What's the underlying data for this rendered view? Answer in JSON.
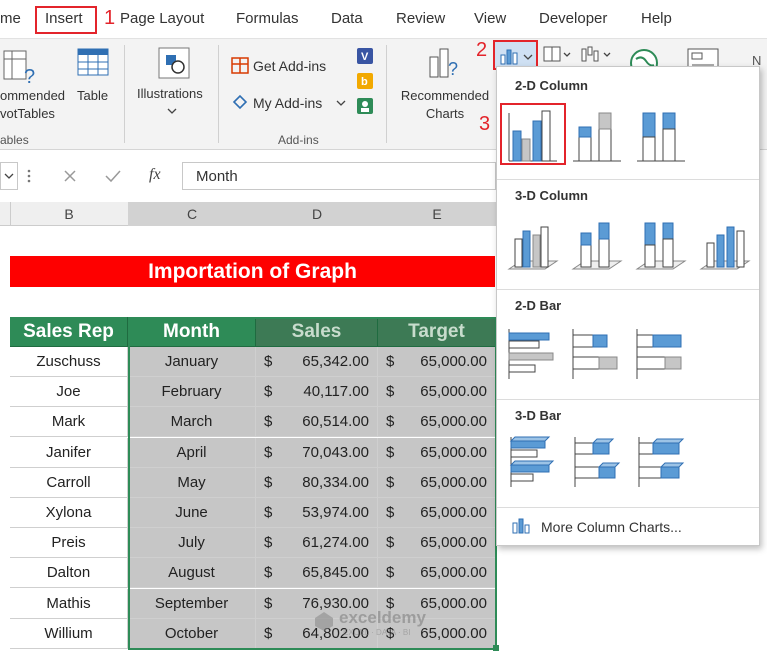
{
  "menu": {
    "tabs": [
      "me",
      "Insert",
      "Page Layout",
      "Formulas",
      "Data",
      "Review",
      "View",
      "Developer",
      "Help"
    ],
    "step1": "1",
    "step2": "2",
    "step3": "3"
  },
  "ribbon": {
    "recommended_pivot": "ommended\nvotTables",
    "table": "Table",
    "illustrations": "Illustrations",
    "get_addins": "Get Add-ins",
    "my_addins": "My Add-ins",
    "recommended_charts": "Recommended\nCharts",
    "group_tables": "ables",
    "group_addins": "Add-ins"
  },
  "formula_bar": {
    "fx": "fx",
    "value": "Month"
  },
  "columns": [
    "B",
    "C",
    "D",
    "E"
  ],
  "sheet": {
    "title": "Importation of Graph",
    "headers": [
      "Sales Rep",
      "Month",
      "Sales",
      "Target"
    ],
    "currency": "$",
    "rows": [
      {
        "rep": "Zuschuss",
        "month": "January",
        "sales": "65,342.00",
        "target": "65,000.00"
      },
      {
        "rep": "Joe",
        "month": "February",
        "sales": "40,117.00",
        "target": "65,000.00"
      },
      {
        "rep": "Mark",
        "month": "March",
        "sales": "60,514.00",
        "target": "65,000.00"
      },
      {
        "rep": "Janifer",
        "month": "April",
        "sales": "70,043.00",
        "target": "65,000.00"
      },
      {
        "rep": "Carroll",
        "month": "May",
        "sales": "80,334.00",
        "target": "65,000.00"
      },
      {
        "rep": "Xylona",
        "month": "June",
        "sales": "53,974.00",
        "target": "65,000.00"
      },
      {
        "rep": "Preis",
        "month": "July",
        "sales": "61,274.00",
        "target": "65,000.00"
      },
      {
        "rep": "Dalton",
        "month": "August",
        "sales": "65,845.00",
        "target": "65,000.00"
      },
      {
        "rep": "Mathis",
        "month": "September",
        "sales": "76,930.00",
        "target": "65,000.00"
      },
      {
        "rep": "Willium",
        "month": "October",
        "sales": "64,802.00",
        "target": "65,000.00"
      }
    ]
  },
  "dropdown": {
    "section_2d_column": "2-D Column",
    "section_3d_column": "3-D Column",
    "section_2d_bar": "2-D Bar",
    "section_3d_bar": "3-D Bar",
    "more": "More Column Charts..."
  },
  "watermark": {
    "brand": "exceldemy",
    "tagline": "EXCEL · DATA · BI"
  },
  "colors": {
    "header_green": "#2e8b57",
    "title_red": "#fe0000",
    "highlight_red": "#e3242b",
    "chart_blue": "#5b9bd5"
  }
}
